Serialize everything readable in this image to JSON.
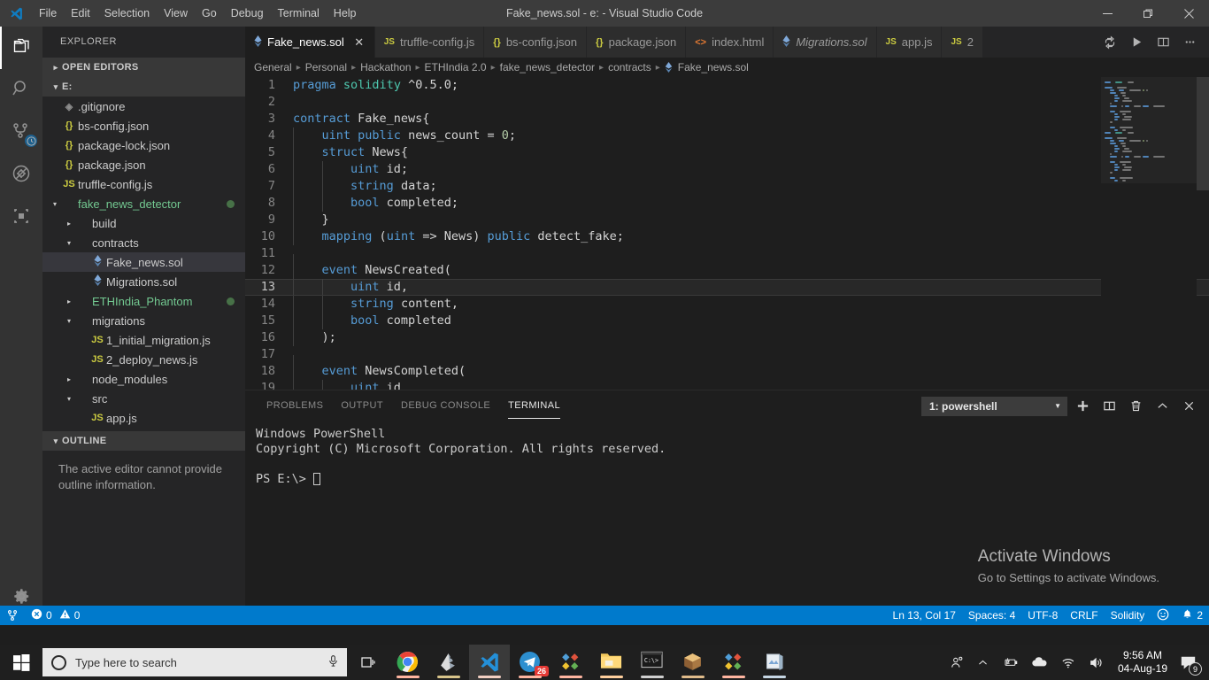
{
  "titlebar": {
    "logo_icon": "vscode-logo-icon",
    "menus": [
      "File",
      "Edit",
      "Selection",
      "View",
      "Go",
      "Debug",
      "Terminal",
      "Help"
    ],
    "window_title": "Fake_news.sol - e: - Visual Studio Code",
    "controls": [
      {
        "name": "minimize-button",
        "icon": "minimize-icon"
      },
      {
        "name": "restore-button",
        "icon": "restore-icon"
      },
      {
        "name": "close-button",
        "icon": "close-icon"
      }
    ]
  },
  "activity_bar": {
    "items": [
      {
        "name": "explorer",
        "icon": "files-icon",
        "active": true,
        "badge": null
      },
      {
        "name": "search",
        "icon": "search-icon",
        "active": false,
        "badge": null
      },
      {
        "name": "source-control",
        "icon": "source-control-icon",
        "active": false,
        "badge": "clock"
      },
      {
        "name": "debug",
        "icon": "debug-no-icon",
        "active": false,
        "badge": null
      },
      {
        "name": "extensions",
        "icon": "extensions-icon",
        "active": false,
        "badge": null
      },
      {
        "name": "manage",
        "icon": "gear-icon",
        "active": false,
        "badge": null
      }
    ]
  },
  "sidebar": {
    "title": "EXPLORER",
    "sections": [
      {
        "label": "OPEN EDITORS",
        "expanded": false
      },
      {
        "label": "E:",
        "expanded": true
      },
      {
        "label": "OUTLINE",
        "expanded": true
      }
    ],
    "tree": [
      {
        "label": ".gitignore",
        "icon": "git-icon",
        "indent": 1,
        "kind": "file",
        "arrow": "",
        "selected": false,
        "dot": false
      },
      {
        "label": "bs-config.json",
        "icon": "json-icon",
        "indent": 1,
        "kind": "file",
        "arrow": "",
        "selected": false,
        "dot": false
      },
      {
        "label": "package-lock.json",
        "icon": "json-icon",
        "indent": 1,
        "kind": "file",
        "arrow": "",
        "selected": false,
        "dot": false
      },
      {
        "label": "package.json",
        "icon": "json-icon",
        "indent": 1,
        "kind": "file",
        "arrow": "",
        "selected": false,
        "dot": false
      },
      {
        "label": "truffle-config.js",
        "icon": "js-icon",
        "indent": 1,
        "kind": "file",
        "arrow": "",
        "selected": false,
        "dot": false
      },
      {
        "label": "fake_news_detector",
        "icon": "",
        "indent": 1,
        "kind": "folder-green",
        "arrow": "▾",
        "selected": false,
        "dot": true
      },
      {
        "label": "build",
        "icon": "",
        "indent": 2,
        "kind": "folder",
        "arrow": "▸",
        "selected": false,
        "dot": false
      },
      {
        "label": "contracts",
        "icon": "",
        "indent": 2,
        "kind": "folder",
        "arrow": "▾",
        "selected": false,
        "dot": false
      },
      {
        "label": "Fake_news.sol",
        "icon": "solidity-icon",
        "indent": 3,
        "kind": "file",
        "arrow": "",
        "selected": true,
        "dot": false
      },
      {
        "label": "Migrations.sol",
        "icon": "solidity-icon",
        "indent": 3,
        "kind": "file",
        "arrow": "",
        "selected": false,
        "dot": false
      },
      {
        "label": "ETHIndia_Phantom",
        "icon": "",
        "indent": 2,
        "kind": "folder-green",
        "arrow": "▸",
        "selected": false,
        "dot": true
      },
      {
        "label": "migrations",
        "icon": "",
        "indent": 2,
        "kind": "folder",
        "arrow": "▾",
        "selected": false,
        "dot": false
      },
      {
        "label": "1_initial_migration.js",
        "icon": "js-icon",
        "indent": 3,
        "kind": "file",
        "arrow": "",
        "selected": false,
        "dot": false
      },
      {
        "label": "2_deploy_news.js",
        "icon": "js-icon",
        "indent": 3,
        "kind": "file",
        "arrow": "",
        "selected": false,
        "dot": false
      },
      {
        "label": "node_modules",
        "icon": "",
        "indent": 2,
        "kind": "folder",
        "arrow": "▸",
        "selected": false,
        "dot": false
      },
      {
        "label": "src",
        "icon": "",
        "indent": 2,
        "kind": "folder",
        "arrow": "▾",
        "selected": false,
        "dot": false
      },
      {
        "label": "app.js",
        "icon": "js-icon",
        "indent": 3,
        "kind": "file",
        "arrow": "",
        "selected": false,
        "dot": false
      }
    ],
    "outline_message": "The active editor cannot provide outline information."
  },
  "tabs": [
    {
      "label": "Fake_news.sol",
      "icon": "solidity-icon",
      "active": true,
      "italic": false,
      "close": "✕"
    },
    {
      "label": "truffle-config.js",
      "icon": "js-icon",
      "active": false,
      "italic": false,
      "close": ""
    },
    {
      "label": "bs-config.json",
      "icon": "json-icon",
      "active": false,
      "italic": false,
      "close": ""
    },
    {
      "label": "package.json",
      "icon": "json-icon",
      "active": false,
      "italic": false,
      "close": ""
    },
    {
      "label": "index.html",
      "icon": "html-icon",
      "active": false,
      "italic": false,
      "close": ""
    },
    {
      "label": "Migrations.sol",
      "icon": "solidity-icon",
      "active": false,
      "italic": true,
      "close": ""
    },
    {
      "label": "app.js",
      "icon": "js-icon",
      "active": false,
      "italic": false,
      "close": ""
    },
    {
      "label": "2",
      "icon": "js-icon",
      "active": false,
      "italic": false,
      "close": ""
    }
  ],
  "tab_actions": [
    {
      "name": "source-control-sync-button",
      "icon": "sync-icon"
    },
    {
      "name": "run-button",
      "icon": "play-icon"
    },
    {
      "name": "split-editor-button",
      "icon": "split-icon"
    },
    {
      "name": "more-actions-button",
      "icon": "ellipsis-icon"
    }
  ],
  "breadcrumbs": [
    "General",
    "Personal",
    "Hackathon",
    "ETHIndia 2.0",
    "fake_news_detector",
    "contracts",
    "Fake_news.sol"
  ],
  "editor": {
    "current_line": 13,
    "lines": [
      {
        "n": 1,
        "tokens": [
          {
            "t": "pragma",
            "c": "kw"
          },
          {
            "t": " ",
            "c": "pl"
          },
          {
            "t": "solidity",
            "c": "ty"
          },
          {
            "t": " ^0.5.0;",
            "c": "pl"
          }
        ],
        "guides": 0
      },
      {
        "n": 2,
        "tokens": [],
        "guides": 0
      },
      {
        "n": 3,
        "tokens": [
          {
            "t": "contract",
            "c": "kw"
          },
          {
            "t": " Fake_news{",
            "c": "pl"
          }
        ],
        "guides": 0
      },
      {
        "n": 4,
        "tokens": [
          {
            "t": "    ",
            "c": "pl"
          },
          {
            "t": "uint",
            "c": "kw"
          },
          {
            "t": " ",
            "c": "pl"
          },
          {
            "t": "public",
            "c": "kw"
          },
          {
            "t": " news_count = ",
            "c": "pl"
          },
          {
            "t": "0",
            "c": "num"
          },
          {
            "t": ";",
            "c": "pl"
          }
        ],
        "guides": 1
      },
      {
        "n": 5,
        "tokens": [
          {
            "t": "    ",
            "c": "pl"
          },
          {
            "t": "struct",
            "c": "kw"
          },
          {
            "t": " News{",
            "c": "pl"
          }
        ],
        "guides": 1
      },
      {
        "n": 6,
        "tokens": [
          {
            "t": "        ",
            "c": "pl"
          },
          {
            "t": "uint",
            "c": "kw"
          },
          {
            "t": " id;",
            "c": "pl"
          }
        ],
        "guides": 2
      },
      {
        "n": 7,
        "tokens": [
          {
            "t": "        ",
            "c": "pl"
          },
          {
            "t": "string",
            "c": "kw"
          },
          {
            "t": " data;",
            "c": "pl"
          }
        ],
        "guides": 2
      },
      {
        "n": 8,
        "tokens": [
          {
            "t": "        ",
            "c": "pl"
          },
          {
            "t": "bool",
            "c": "kw"
          },
          {
            "t": " completed;",
            "c": "pl"
          }
        ],
        "guides": 2
      },
      {
        "n": 9,
        "tokens": [
          {
            "t": "    }",
            "c": "pl"
          }
        ],
        "guides": 1
      },
      {
        "n": 10,
        "tokens": [
          {
            "t": "    ",
            "c": "pl"
          },
          {
            "t": "mapping",
            "c": "kw"
          },
          {
            "t": " (",
            "c": "pl"
          },
          {
            "t": "uint",
            "c": "kw"
          },
          {
            "t": " => News) ",
            "c": "pl"
          },
          {
            "t": "public",
            "c": "kw"
          },
          {
            "t": " detect_fake;",
            "c": "pl"
          }
        ],
        "guides": 1
      },
      {
        "n": 11,
        "tokens": [],
        "guides": 1
      },
      {
        "n": 12,
        "tokens": [
          {
            "t": "    ",
            "c": "pl"
          },
          {
            "t": "event",
            "c": "kw"
          },
          {
            "t": " NewsCreated(",
            "c": "pl"
          }
        ],
        "guides": 1
      },
      {
        "n": 13,
        "tokens": [
          {
            "t": "        ",
            "c": "pl"
          },
          {
            "t": "uint",
            "c": "kw"
          },
          {
            "t": " id,",
            "c": "pl"
          }
        ],
        "guides": 2
      },
      {
        "n": 14,
        "tokens": [
          {
            "t": "        ",
            "c": "pl"
          },
          {
            "t": "string",
            "c": "kw"
          },
          {
            "t": " content,",
            "c": "pl"
          }
        ],
        "guides": 2
      },
      {
        "n": 15,
        "tokens": [
          {
            "t": "        ",
            "c": "pl"
          },
          {
            "t": "bool",
            "c": "kw"
          },
          {
            "t": " completed",
            "c": "pl"
          }
        ],
        "guides": 2
      },
      {
        "n": 16,
        "tokens": [
          {
            "t": "    );",
            "c": "pl"
          }
        ],
        "guides": 1
      },
      {
        "n": 17,
        "tokens": [],
        "guides": 1
      },
      {
        "n": 18,
        "tokens": [
          {
            "t": "    ",
            "c": "pl"
          },
          {
            "t": "event",
            "c": "kw"
          },
          {
            "t": " NewsCompleted(",
            "c": "pl"
          }
        ],
        "guides": 1
      },
      {
        "n": 19,
        "tokens": [
          {
            "t": "        ",
            "c": "pl"
          },
          {
            "t": "uint",
            "c": "kw"
          },
          {
            "t": " id,",
            "c": "pl"
          }
        ],
        "guides": 2
      }
    ]
  },
  "panel": {
    "tabs": [
      {
        "label": "PROBLEMS",
        "active": false
      },
      {
        "label": "OUTPUT",
        "active": false
      },
      {
        "label": "DEBUG CONSOLE",
        "active": false
      },
      {
        "label": "TERMINAL",
        "active": true
      }
    ],
    "terminal_selector": "1: powershell",
    "actions": [
      {
        "name": "new-terminal-button",
        "icon": "plus-icon"
      },
      {
        "name": "split-terminal-button",
        "icon": "split-icon"
      },
      {
        "name": "kill-terminal-button",
        "icon": "trash-icon"
      },
      {
        "name": "maximize-panel-button",
        "icon": "chevron-up-icon"
      },
      {
        "name": "close-panel-button",
        "icon": "close-icon"
      }
    ],
    "terminal_lines": [
      "Windows PowerShell",
      "Copyright (C) Microsoft Corporation. All rights reserved.",
      "",
      "PS E:\\> "
    ]
  },
  "watermark": {
    "line1": "Activate Windows",
    "line2": "Go to Settings to activate Windows."
  },
  "statusbar": {
    "left": [
      {
        "name": "remote-branch-icon",
        "icon": "source-control-icon",
        "text": ""
      },
      {
        "name": "errors-warnings",
        "icon": "error-warning-icon",
        "text": "0",
        "text2": "0"
      }
    ],
    "errors": "0",
    "warnings": "0",
    "right": [
      {
        "name": "cursor-position",
        "text": "Ln 13, Col 17"
      },
      {
        "name": "indentation",
        "text": "Spaces: 4"
      },
      {
        "name": "encoding",
        "text": "UTF-8"
      },
      {
        "name": "eol",
        "text": "CRLF"
      },
      {
        "name": "language-mode",
        "text": "Solidity"
      },
      {
        "name": "feedback-smiley",
        "text": "☺"
      },
      {
        "name": "notifications",
        "text": "2"
      }
    ],
    "accent_color": "#007acc"
  },
  "taskbar": {
    "start_icon": "windows-start-icon",
    "search_placeholder": "Type here to search",
    "search_mic_icon": "microphone-icon",
    "taskview_icon": "task-view-icon",
    "apps": [
      {
        "name": "chrome",
        "icon": "chrome-icon",
        "active": false,
        "badge": null
      },
      {
        "name": "bluej",
        "icon": "bluej-icon",
        "active": false,
        "badge": null
      },
      {
        "name": "vscode",
        "icon": "vscode-icon",
        "active": true,
        "badge": null
      },
      {
        "name": "telegram",
        "icon": "telegram-icon",
        "active": false,
        "badge": "26"
      },
      {
        "name": "app-diamonds-1",
        "icon": "diamonds-icon",
        "active": false,
        "badge": null
      },
      {
        "name": "file-explorer",
        "icon": "folder-icon",
        "active": false,
        "badge": null
      },
      {
        "name": "command-prompt",
        "icon": "cmd-icon",
        "active": false,
        "badge": null
      },
      {
        "name": "truffle-box",
        "icon": "box-icon",
        "active": false,
        "badge": null
      },
      {
        "name": "app-diamonds-2",
        "icon": "diamonds-icon",
        "active": false,
        "badge": null
      },
      {
        "name": "photos",
        "icon": "photos-icon",
        "active": false,
        "badge": null
      }
    ],
    "tray": [
      {
        "name": "people-icon",
        "icon": "people-icon"
      },
      {
        "name": "show-hidden-icons",
        "icon": "chevron-up-icon"
      },
      {
        "name": "battery-icon",
        "icon": "battery-charging-icon"
      },
      {
        "name": "onedrive-icon",
        "icon": "cloud-icon"
      },
      {
        "name": "wifi-icon",
        "icon": "wifi-icon"
      },
      {
        "name": "volume-icon",
        "icon": "speaker-icon"
      }
    ],
    "clock_time": "9:56 AM",
    "clock_date": "04-Aug-19",
    "notification_count": "9"
  }
}
